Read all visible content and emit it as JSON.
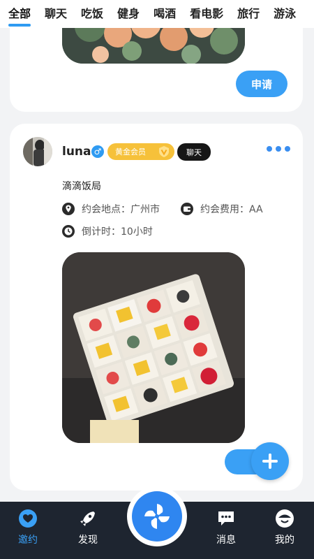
{
  "tabs": [
    "全部",
    "聊天",
    "吃饭",
    "健身",
    "喝酒",
    "看电影",
    "旅行",
    "游泳"
  ],
  "active_tab": "全部",
  "card1": {
    "apply_label": "申请"
  },
  "card2": {
    "username": "luna",
    "gender_symbol": "♂",
    "vip_label": "黄金会员",
    "chat_label": "聊天",
    "title": "滴滴饭局",
    "location": "约会地点：广州市",
    "fee": "约会费用：AA",
    "countdown": "倒计时：10小时"
  },
  "bottom_nav": {
    "invite": "邀约",
    "discover": "发现",
    "messages": "消息",
    "mine": "我的"
  },
  "colors": {
    "accent": "#3aa0f5",
    "vip": "#f6c13a",
    "dark": "#1e2530"
  }
}
